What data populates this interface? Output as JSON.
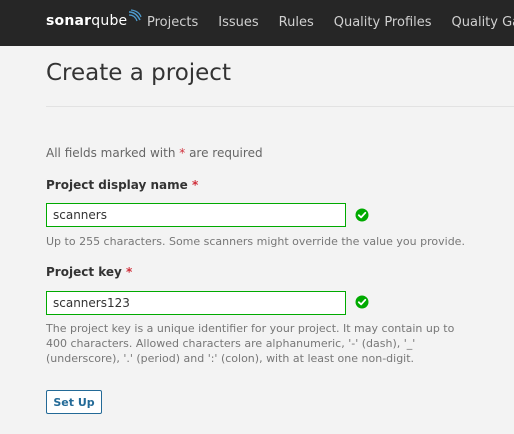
{
  "header": {
    "logo_text_bold": "sonar",
    "logo_text_light": "qube",
    "nav": [
      "Projects",
      "Issues",
      "Rules",
      "Quality Profiles",
      "Quality Gates"
    ]
  },
  "page": {
    "title": "Create a project",
    "required_note_before": "All fields marked with ",
    "required_note_star": "*",
    "required_note_after": " are required"
  },
  "form": {
    "name_label": "Project display name",
    "name_required_star": "*",
    "name_value": "scanners",
    "name_help": "Up to 255 characters. Some scanners might override the value you provide.",
    "key_label": "Project key",
    "key_required_star": "*",
    "key_value": "scanners123",
    "key_help_lines": [
      "The project key is a unique identifier for your project. It may contain up to",
      "400 characters. Allowed characters are alphanumeric, '-' (dash), '_'",
      "(underscore), '.' (period) and ':' (colon), with at least one non-digit."
    ],
    "submit_label": "Set Up"
  },
  "colors": {
    "topbar": "#262626",
    "valid": "#00aa00",
    "required": "#d02f3a",
    "primary": "#236a97"
  },
  "icons": {
    "valid": "check-circle-icon"
  }
}
